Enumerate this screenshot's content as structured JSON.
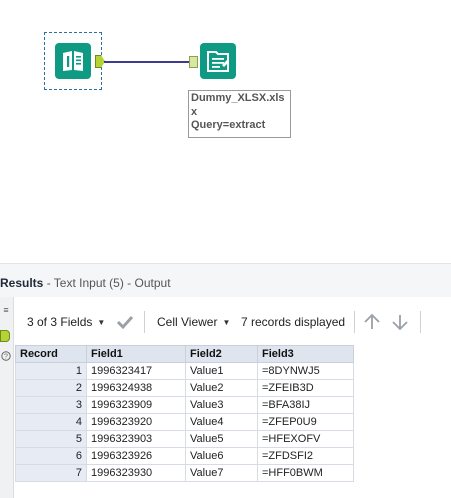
{
  "canvas": {
    "input_tool": {
      "icon": "text-input-book-icon"
    },
    "output_tool": {
      "icon": "output-data-icon",
      "label": "Dummy_XLSX.xls\nx\nQuery=extract"
    }
  },
  "results": {
    "title": "Results",
    "subtitle": " - Text Input (5) - Output",
    "fields_label": "3 of 3 Fields",
    "cell_viewer_label": "Cell Viewer",
    "records_displayed": "7 records displayed",
    "columns": [
      "Record",
      "Field1",
      "Field2",
      "Field3"
    ],
    "rows": [
      [
        "1",
        "1996323417",
        "Value1",
        "=8DYNWJ5"
      ],
      [
        "2",
        "1996324938",
        "Value2",
        "=ZFEIB3D"
      ],
      [
        "3",
        "1996323909",
        "Value3",
        "=BFA38IJ"
      ],
      [
        "4",
        "1996323920",
        "Value4",
        "=ZFEP0U9"
      ],
      [
        "5",
        "1996323903",
        "Value5",
        "=HFEXOFV"
      ],
      [
        "6",
        "1996323926",
        "Value6",
        "=ZFDSFI2"
      ],
      [
        "7",
        "1996323930",
        "Value7",
        "=HFF0BWM"
      ]
    ]
  },
  "colors": {
    "tool_teal": "#0f9b83",
    "connector": "#3e3a8f",
    "anchor_green": "#b5d334",
    "header_blue": "#dfe5ef"
  }
}
